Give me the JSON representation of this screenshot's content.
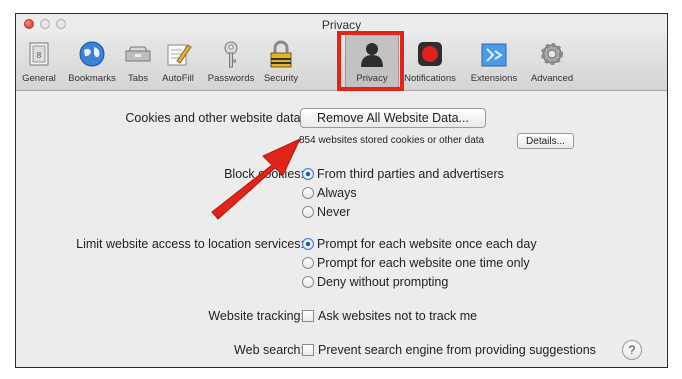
{
  "window": {
    "title": "Privacy"
  },
  "toolbar": {
    "items": [
      {
        "label": "General",
        "icon": "general-icon"
      },
      {
        "label": "Bookmarks",
        "icon": "globe-icon"
      },
      {
        "label": "Tabs",
        "icon": "tabs-icon"
      },
      {
        "label": "AutoFill",
        "icon": "autofill-pencil-icon"
      },
      {
        "label": "Passwords",
        "icon": "key-icon"
      },
      {
        "label": "Security",
        "icon": "padlock-icon"
      },
      {
        "label": "Privacy",
        "icon": "person-silhouette-icon"
      },
      {
        "label": "Notifications",
        "icon": "record-icon"
      },
      {
        "label": "Extensions",
        "icon": "puzzle-icon"
      },
      {
        "label": "Advanced",
        "icon": "gears-icon"
      }
    ],
    "selected": "Privacy"
  },
  "cookies": {
    "label": "Cookies and other website data:",
    "remove_button": "Remove All Website Data...",
    "stored_text": "854 websites stored cookies or other data",
    "details_button": "Details..."
  },
  "block_cookies": {
    "label": "Block cookies:",
    "options": [
      "From third parties and advertisers",
      "Always",
      "Never"
    ],
    "selected": "From third parties and advertisers"
  },
  "location": {
    "label": "Limit website access to location services:",
    "options": [
      "Prompt for each website once each day",
      "Prompt for each website one time only",
      "Deny without prompting"
    ],
    "selected": "Prompt for each website once each day"
  },
  "tracking": {
    "label": "Website tracking:",
    "checkbox": "Ask websites not to track me",
    "checked": false
  },
  "web_search": {
    "label": "Web search:",
    "checkbox": "Prevent search engine from providing suggestions",
    "checked": false,
    "help": "?"
  },
  "colors": {
    "annotation": "#e2231a",
    "selected_radio": "#1e5fb5"
  }
}
